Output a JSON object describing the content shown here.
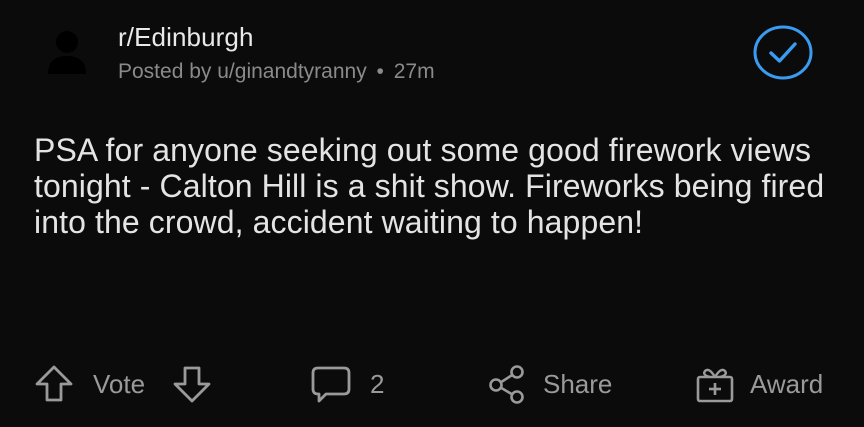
{
  "post": {
    "subreddit": "r/Edinburgh",
    "posted_by_prefix": "Posted by",
    "author": "u/ginandtyranny",
    "separator": "•",
    "age": "27m",
    "title": "PSA for anyone seeking out some good firework views tonight - Calton Hill is a shit show. Fireworks being fired into the crowd, accident waiting to happen!"
  },
  "actions": {
    "vote_label": "Vote",
    "comment_count": "2",
    "share_label": "Share",
    "award_label": "Award"
  },
  "icons": {
    "avatar": "avatar-icon",
    "mod_check": "check-circle-icon",
    "upvote": "arrow-up-icon",
    "downvote": "arrow-down-icon",
    "comments": "comment-bubble-icon",
    "share": "share-icon",
    "award": "gift-icon"
  },
  "colors": {
    "background": "#0b0b0b",
    "text": "#e4e4e4",
    "muted": "#8a8a8a",
    "accent": "#3a9bf0"
  }
}
